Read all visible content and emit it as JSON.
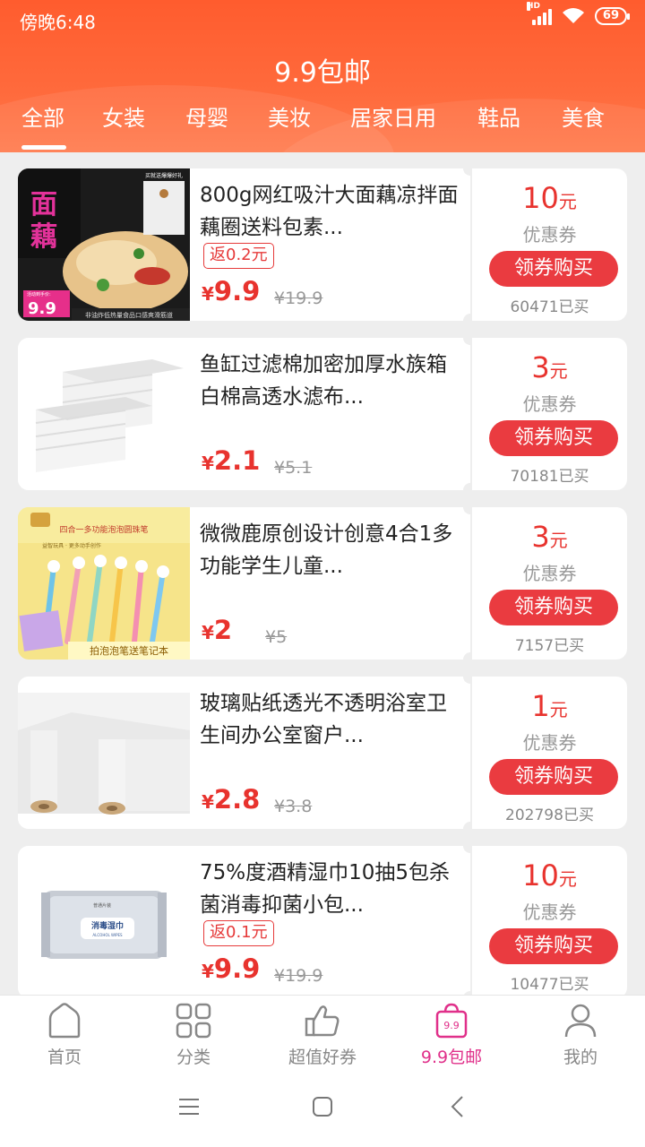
{
  "status_bar": {
    "time": "傍晚6:48",
    "battery": "69",
    "network": "HD"
  },
  "header": {
    "title": "9.9包邮"
  },
  "tabs": [
    {
      "label": "全部",
      "active": true
    },
    {
      "label": "女装"
    },
    {
      "label": "母婴"
    },
    {
      "label": "美妆"
    },
    {
      "label": "居家日用"
    },
    {
      "label": "鞋品"
    },
    {
      "label": "美食"
    }
  ],
  "products": [
    {
      "title": "800g网红吸汁大面藕凉拌面藕圈送料包素...",
      "rebate": "返0.2元",
      "yen": "¥",
      "price": "9.9",
      "original_price": "¥19.9",
      "coupon_amount": "10",
      "coupon_unit": "元",
      "coupon_label": "优惠券",
      "buy_label": "领券购买",
      "sold": "60471已买",
      "image_text": {
        "big1": "面",
        "big2": "藕",
        "price_tag": "9.9",
        "promo_small": "活动到手价:",
        "caption": "非油炸低热量食品口感爽滑筋道",
        "gift": "买就送爆爆好礼"
      }
    },
    {
      "title": "鱼缸过滤棉加密加厚水族箱白棉高透水滤布...",
      "rebate": "",
      "yen": "¥",
      "price": "2.1",
      "original_price": "¥5.1",
      "coupon_amount": "3",
      "coupon_unit": "元",
      "coupon_label": "优惠券",
      "buy_label": "领券购买",
      "sold": "70181已买"
    },
    {
      "title": "微微鹿原创设计创意4合1多功能学生儿童...",
      "rebate": "",
      "yen": "¥",
      "price": "2",
      "original_price": "¥5",
      "coupon_amount": "3",
      "coupon_unit": "元",
      "coupon_label": "优惠券",
      "buy_label": "领券购买",
      "sold": "7157已买",
      "image_text": {
        "headline": "四合一多功能泡泡圆珠笔",
        "subline": "益智玩具 · 更多动手创作",
        "caption": "拍泡泡笔送笔记本"
      }
    },
    {
      "title": "玻璃贴纸透光不透明浴室卫生间办公室窗户...",
      "rebate": "",
      "yen": "¥",
      "price": "2.8",
      "original_price": "¥3.8",
      "coupon_amount": "1",
      "coupon_unit": "元",
      "coupon_label": "优惠券",
      "buy_label": "领券购买",
      "sold": "202798已买"
    },
    {
      "title": "75%度酒精湿巾10抽5包杀菌消毒抑菌小包...",
      "rebate": "返0.1元",
      "yen": "¥",
      "price": "9.9",
      "original_price": "¥19.9",
      "coupon_amount": "10",
      "coupon_unit": "元",
      "coupon_label": "优惠券",
      "buy_label": "领券购买",
      "sold": "10477已买",
      "image_text": {
        "pack": "消毒湿巾",
        "pack_sub": "ALCOHOL WIPES",
        "brand": "普通片装"
      }
    }
  ],
  "bottom_nav": [
    {
      "label": "首页",
      "icon": "home-icon"
    },
    {
      "label": "分类",
      "icon": "grid-icon"
    },
    {
      "label": "超值好券",
      "icon": "thumbs-up-icon"
    },
    {
      "label": "9.9包邮",
      "icon": "shopping-bag-icon",
      "badge": "9.9",
      "active": true
    },
    {
      "label": "我的",
      "icon": "user-icon"
    }
  ],
  "colors": {
    "header": "#ff5c2e",
    "price": "#e8332e",
    "button": "#ea3b40",
    "active_nav": "#e0308a",
    "background": "#eeeeee"
  }
}
